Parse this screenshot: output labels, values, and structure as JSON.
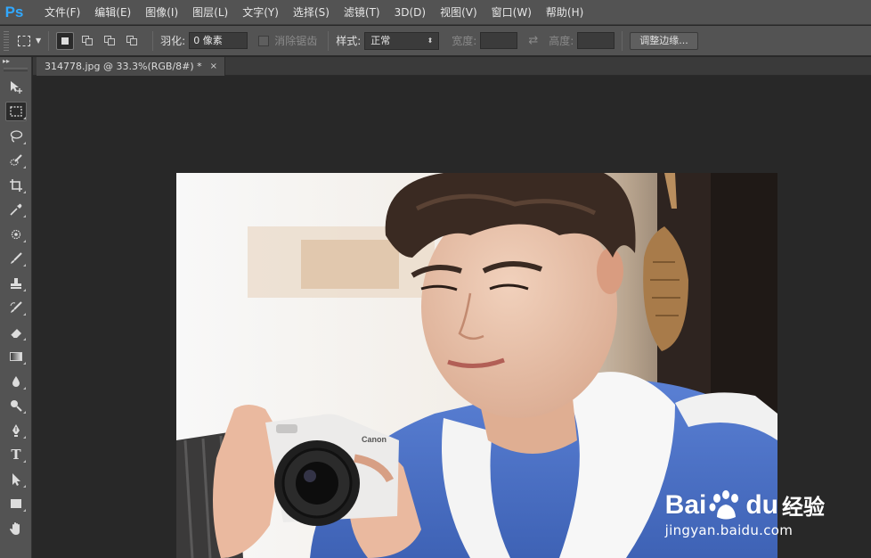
{
  "app": {
    "logo": "Ps"
  },
  "menu": [
    "文件(F)",
    "编辑(E)",
    "图像(I)",
    "图层(L)",
    "文字(Y)",
    "选择(S)",
    "滤镜(T)",
    "3D(D)",
    "视图(V)",
    "窗口(W)",
    "帮助(H)"
  ],
  "options": {
    "feather_label": "羽化:",
    "feather_value": "0 像素",
    "antialias_label": "消除锯齿",
    "style_label": "样式:",
    "style_value": "正常",
    "width_label": "宽度:",
    "height_label": "高度:",
    "refine_edge_label": "调整边缘..."
  },
  "document": {
    "tab_title": "314778.jpg @ 33.3%(RGB/8#) *",
    "close_glyph": "×"
  },
  "tools": [
    "move-tool",
    "rectangular-marquee-tool",
    "lasso-tool",
    "quick-selection-tool",
    "crop-tool",
    "eyedropper-tool",
    "spot-healing-brush-tool",
    "brush-tool",
    "clone-stamp-tool",
    "history-brush-tool",
    "eraser-tool",
    "gradient-tool",
    "blur-tool",
    "dodge-tool",
    "pen-tool",
    "type-tool",
    "path-selection-tool",
    "rectangle-tool",
    "hand-tool"
  ],
  "active_tool": "rectangular-marquee-tool",
  "type_tool_glyph": "T",
  "watermark": {
    "brand_left": "Bai",
    "brand_right": "du",
    "cn_text": "经验",
    "url": "jingyan.baidu.com"
  },
  "colors": {
    "ps_blue": "#31a8ff",
    "ui_panel": "#535353",
    "canvas_bg": "#282828",
    "shirt_blue": "#4a6fc4"
  }
}
